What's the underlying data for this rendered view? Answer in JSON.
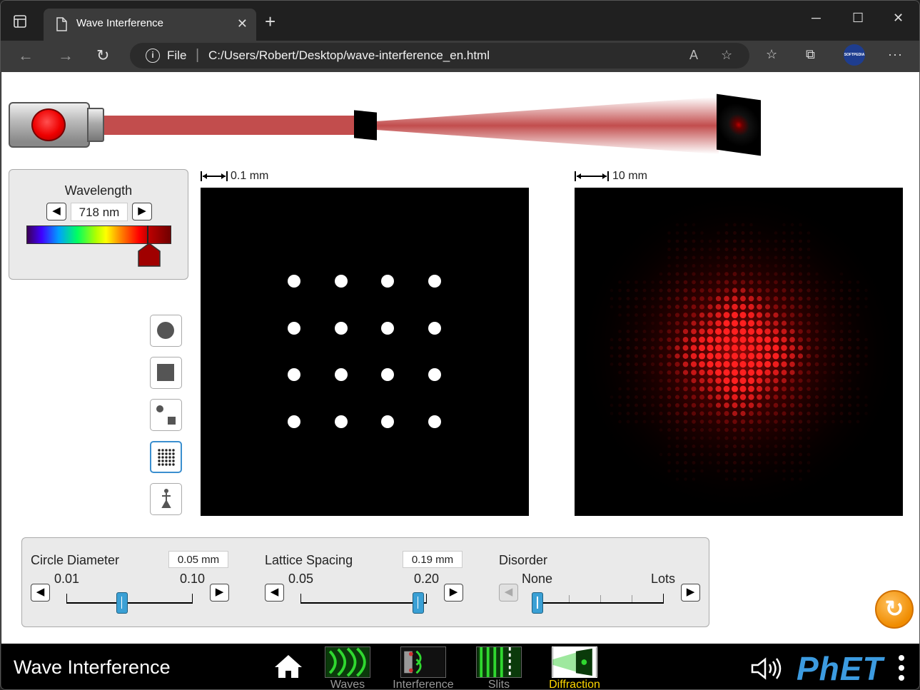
{
  "browser": {
    "tab_title": "Wave Interference",
    "address_scheme": "File",
    "url": "C:/Users/Robert/Desktop/wave-interference_en.html",
    "profile_badge": "SOFTPEDIA"
  },
  "sim": {
    "wavelength": {
      "title": "Wavelength",
      "value": "718 nm"
    },
    "aperture_scale": "0.1 mm",
    "pattern_scale": "10 mm",
    "controls": {
      "circle_diameter": {
        "label": "Circle Diameter",
        "value": "0.05 mm",
        "min_label": "0.01",
        "max_label": "0.10",
        "level": 0.44
      },
      "lattice_spacing": {
        "label": "Lattice Spacing",
        "value": "0.19 mm",
        "min_label": "0.05",
        "max_label": "0.20",
        "level": 0.93
      },
      "disorder": {
        "label": "Disorder",
        "min_label": "None",
        "max_label": "Lots",
        "level": 0.0
      }
    }
  },
  "navbar": {
    "title": "Wave Interference",
    "screens": [
      {
        "label": "Waves"
      },
      {
        "label": "Interference"
      },
      {
        "label": "Slits"
      },
      {
        "label": "Diffraction"
      }
    ],
    "logo": "PhET"
  },
  "colors": {
    "accent": "#3b8fcf",
    "laser": "#c24d4d",
    "slider_thumb": "#3aa0d5",
    "reset": "#f08c00",
    "active_screen": "#ffd700"
  }
}
